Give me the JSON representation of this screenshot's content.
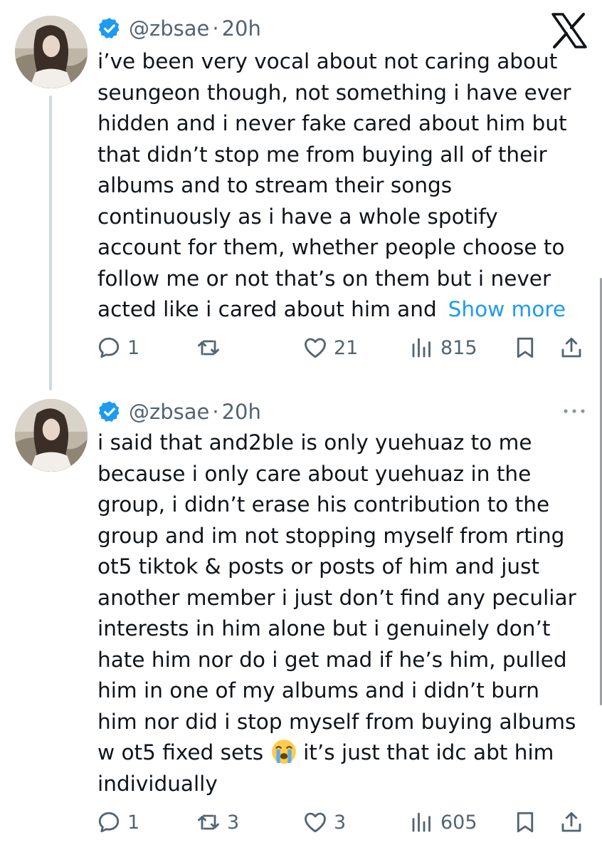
{
  "app": {
    "logo": "x-logo-icon"
  },
  "tweets": [
    {
      "handle": "@zbsae",
      "separator": "·",
      "time": "20h",
      "lines": [
        "i’ve been very vocal about not caring about",
        "seungeon though, not something i have ever",
        "hidden and i never fake cared about him but",
        "that didn’t stop me from buying all of their",
        "albums and to stream their songs",
        "continuously as i have a whole spotify",
        "account for them, whether people choose to",
        "follow me or not that’s on them but i never",
        "acted like i cared about him and"
      ],
      "show_more": "Show more",
      "replies": "1",
      "retweets": "",
      "likes": "21",
      "views": "815"
    },
    {
      "handle": "@zbsae",
      "separator": "·",
      "time": "20h",
      "lines": [
        "i said that and2ble is only yuehuaz to me",
        "because i only care about yuehuaz in the",
        "group, i didn’t erase his contribution to the",
        "group and im not stopping myself from rting",
        "ot5 tiktok & posts or posts of him and just",
        "another member i just don’t find any peculiar",
        "interests in him alone but i genuinely don’t",
        "hate him nor do i get mad if he’s him, pulled",
        "him in one of my albums and i didn’t burn",
        "him nor did i stop myself from buying albums",
        "w ot5 fixed sets",
        "it’s just that idc abt him",
        "individually"
      ],
      "emoji": "loudly-crying-face-emoji",
      "replies": "1",
      "retweets": "3",
      "likes": "3",
      "views": "605"
    }
  ],
  "colors": {
    "accent": "#1d9bf0",
    "secondary_text": "#536471",
    "thread_line": "#cfd9de"
  }
}
